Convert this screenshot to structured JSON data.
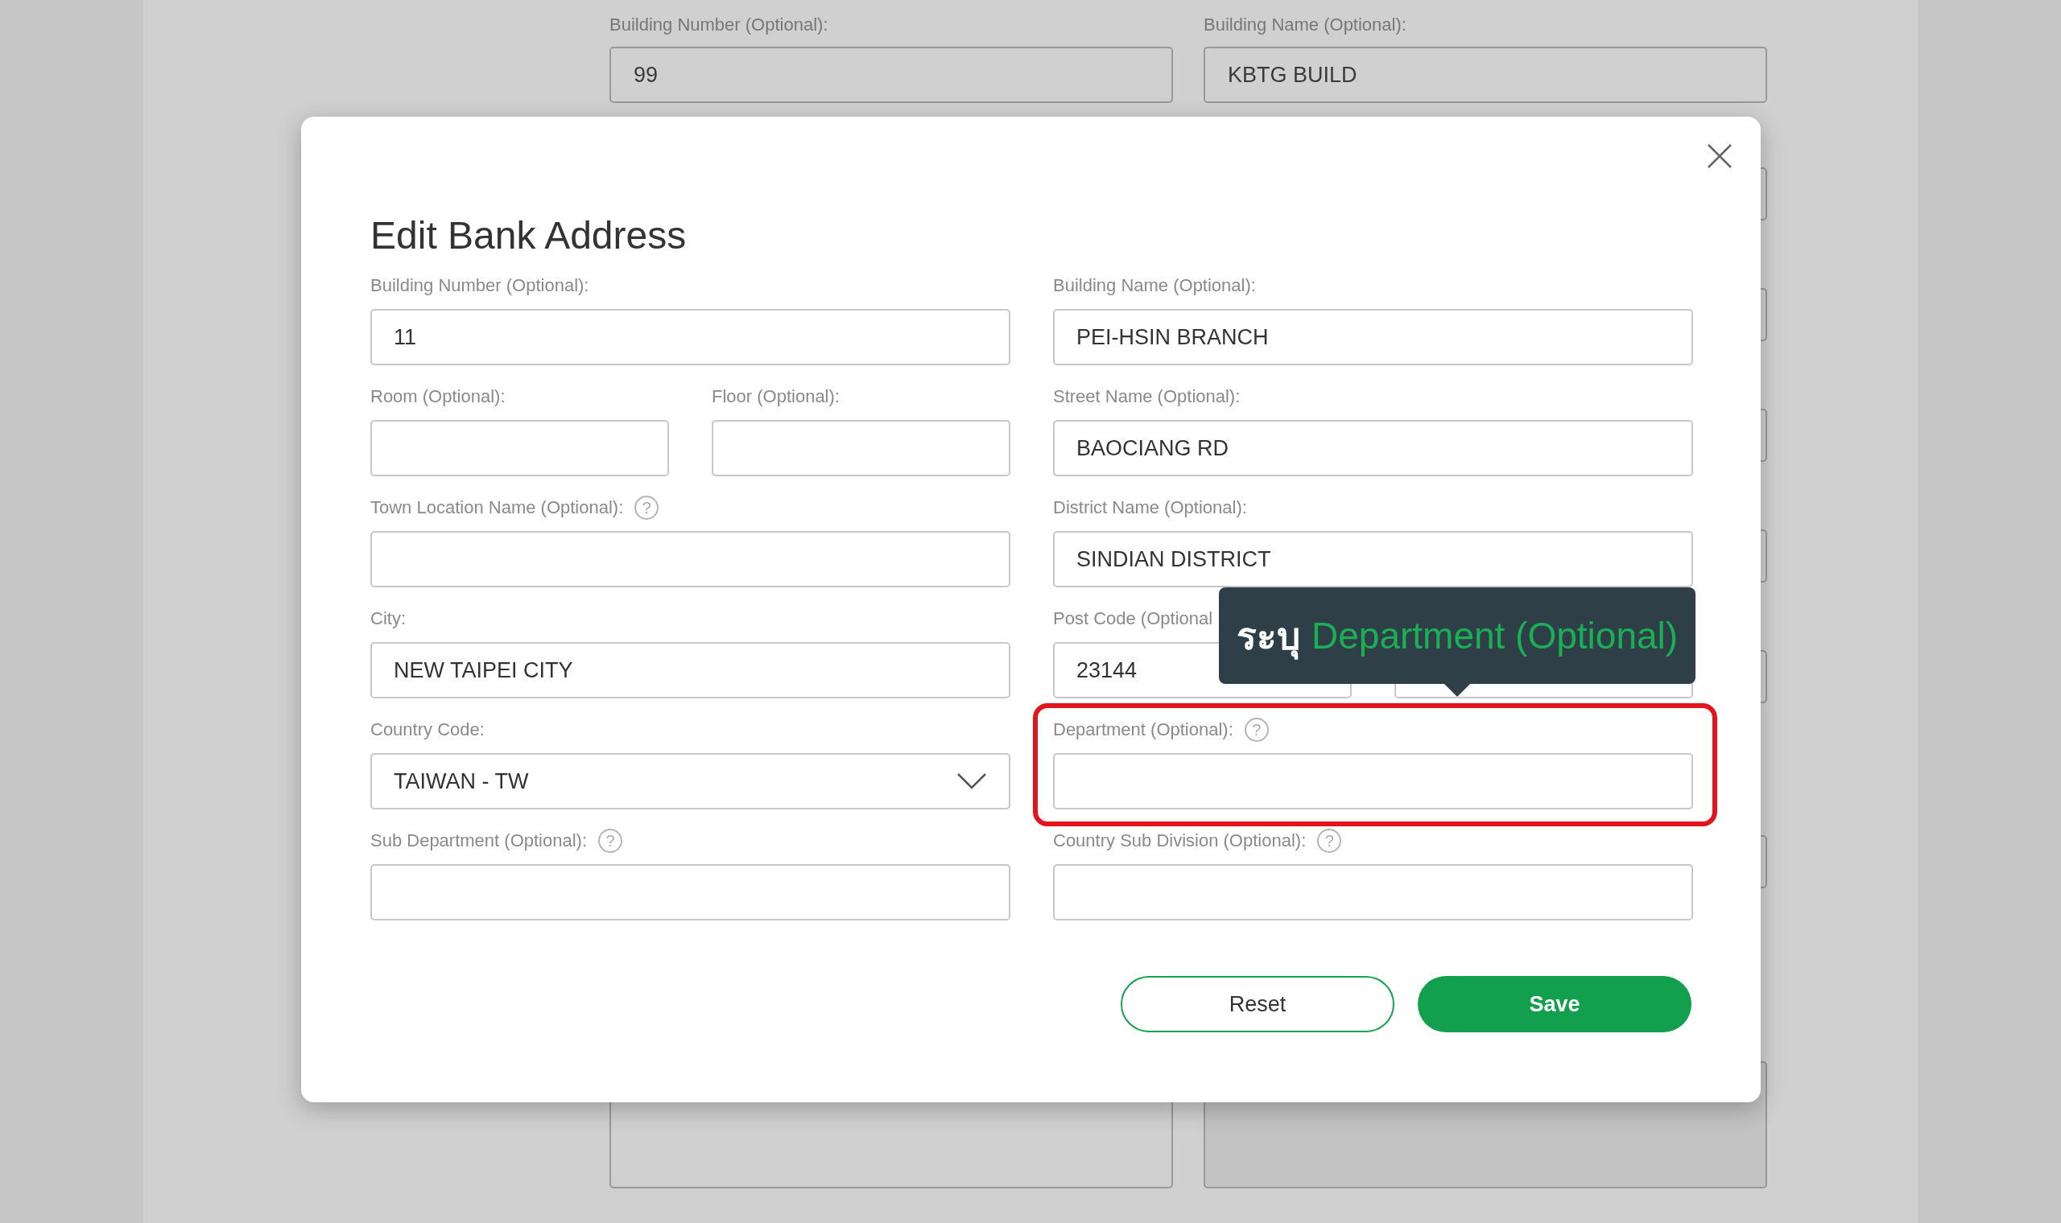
{
  "background_form": {
    "fields": [
      {
        "label": "Building Number (Optional):",
        "value": "99"
      },
      {
        "label": "Building Name (Optional):",
        "value": "KBTG BUILD"
      }
    ],
    "lower_boxes": [
      {
        "disabled": false
      },
      {
        "disabled": true
      }
    ]
  },
  "dialog": {
    "title": "Edit Bank Address",
    "rows": [
      {
        "left": [
          {
            "kind": "text",
            "label": "Building Number (Optional):",
            "value": "11"
          }
        ],
        "right": [
          {
            "kind": "text",
            "label": "Building Name (Optional):",
            "value": "PEI-HSIN BRANCH"
          }
        ]
      },
      {
        "left": [
          {
            "kind": "text",
            "label": "Room (Optional):"
          },
          {
            "kind": "text",
            "label": "Floor (Optional):"
          }
        ],
        "right": [
          {
            "kind": "text",
            "label": "Street Name (Optional):",
            "value": "BAOCIANG RD"
          }
        ]
      },
      {
        "left": [
          {
            "kind": "text",
            "label": "Town Location Name (Optional):",
            "help": "?"
          }
        ],
        "right": [
          {
            "kind": "text",
            "label": "District Name (Optional):",
            "value": "SINDIAN DISTRICT"
          }
        ]
      },
      {
        "left": [
          {
            "kind": "text",
            "label": "City:",
            "value": "NEW TAIPEI CITY"
          }
        ],
        "right": [
          {
            "kind": "text",
            "label": "Post Code (Optional",
            "value": "23144"
          },
          {
            "kind": "text"
          }
        ]
      },
      {
        "left": [
          {
            "kind": "select",
            "label": "Country Code:",
            "value": "TAIWAN - TW"
          }
        ],
        "right": [
          {
            "kind": "text",
            "label": "Department (Optional):",
            "help": "?",
            "highlighted": true
          }
        ]
      },
      {
        "left": [
          {
            "kind": "text",
            "label": "Sub Department (Optional):",
            "help": "?"
          }
        ],
        "right": [
          {
            "kind": "text",
            "label": "Country Sub Division (Optional):",
            "help": "?"
          }
        ]
      }
    ],
    "tooltip": {
      "prefix": "ระบุ",
      "text": "Department (Optional)"
    },
    "buttons": [
      {
        "kind": "secondary",
        "label": "Reset"
      },
      {
        "kind": "primary",
        "label": "Save"
      }
    ]
  }
}
